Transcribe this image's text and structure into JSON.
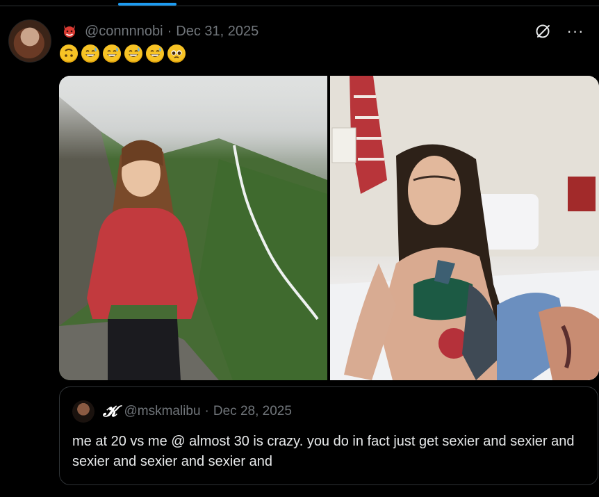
{
  "post": {
    "handle": "@connnnobi",
    "separator": "·",
    "date": "Dec 31, 2025",
    "more_label": "···",
    "emojis": [
      "upside-down-face",
      "grinning-sweat",
      "grinning-sweat",
      "grinning-sweat",
      "grinning-sweat",
      "pleading-face"
    ]
  },
  "quote": {
    "badge": "𝓚",
    "handle": "@mskmalibu",
    "separator": "·",
    "date": "Dec 28, 2025",
    "text": "me at 20 vs me @ almost 30 is crazy. you do in fact just get sexier and sexier and sexier and sexier and sexier and"
  },
  "colors": {
    "background": "#000000",
    "text": "#e7e9ea",
    "muted": "#71767b",
    "border": "#2f3336",
    "accent": "#1d9bf0"
  }
}
